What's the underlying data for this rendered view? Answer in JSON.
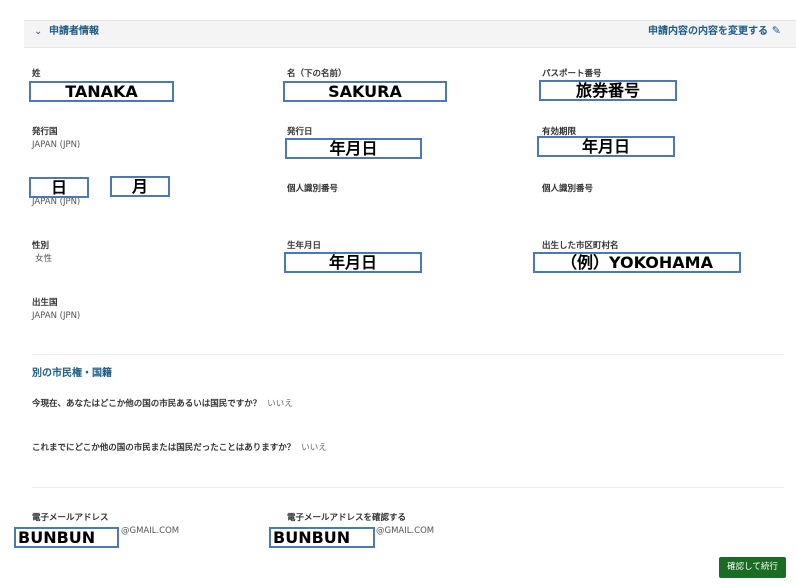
{
  "section": {
    "title": "申請者情報",
    "edit_link": "申請内容の内容を変更する"
  },
  "fields": {
    "surname_label": "姓",
    "surname_value": "TANAKA",
    "given_label": "名（下の名前）",
    "given_value": "SAKURA",
    "passport_label": "パスポート番号",
    "passport_value": "旅券番号",
    "issuing_country_label": "発行国",
    "issuing_country_value": "JAPAN (JPN)",
    "issue_date_label": "発行日",
    "issue_date_value": "年月日",
    "expiry_label": "有効期限",
    "expiry_value": "年月日",
    "day_box": "日",
    "month_box": "月",
    "nationality_value": "JAPAN (JPN)",
    "personal_id_label_1": "個人識別番号",
    "personal_id_label_2": "個人識別番号",
    "sex_label": "性別",
    "sex_value": "女性",
    "dob_label": "生年月日",
    "dob_value": "年月日",
    "birth_city_label": "出生した市区町村名",
    "birth_city_value": "（例）YOKOHAMA",
    "birth_country_label": "出生国",
    "birth_country_value": "JAPAN (JPN)"
  },
  "citizenship": {
    "title": "別の市民権・国籍",
    "q1": "今現在、あなたはどこか他の国の市民あるいは国民ですか？",
    "a1": "いいえ",
    "q2": "これまでにどこか他の国の市民または国民だったことはありますか？",
    "a2": "いいえ"
  },
  "email": {
    "label": "電子メールアドレス",
    "confirm_label": "電子メールアドレスを確認する",
    "user_box": "BUNBUN",
    "domain": "@GMAIL.COM",
    "confirm_user_box": "BUNBUN",
    "confirm_domain": "@GMAIL.COM"
  },
  "buttons": {
    "confirm_continue": "確認して続行"
  }
}
